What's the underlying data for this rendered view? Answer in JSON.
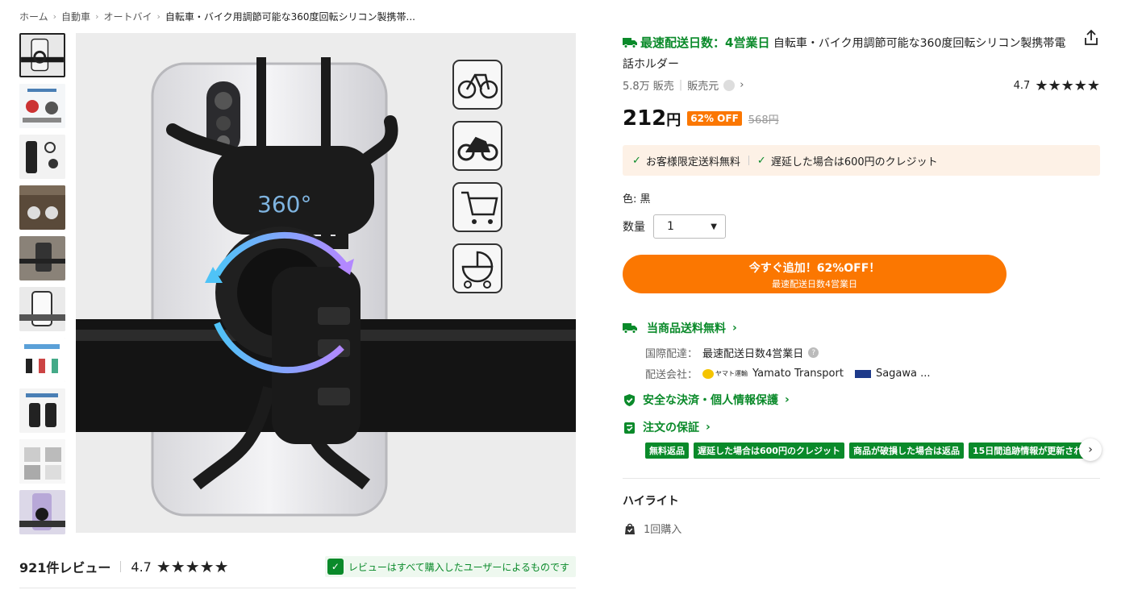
{
  "breadcrumb": {
    "items": [
      "ホーム",
      "自動車",
      "オートバイ",
      "自転車・バイク用調節可能な360度回転シリコン製携帯..."
    ],
    "separator": "›"
  },
  "gallery": {
    "thumbnail_count": 10,
    "main_image": {
      "badge_text": "360°",
      "icons": [
        "bicycle-icon",
        "motorcycle-icon",
        "shopping-cart-icon",
        "stroller-icon"
      ]
    }
  },
  "reviews": {
    "count_label": "921件レビュー",
    "rating": "4.7",
    "stars": "★★★★★",
    "rating_value": 4.7,
    "verified_text": "レビューはすべて購入したユーザーによるものです"
  },
  "product": {
    "fast_delivery": "最速配送日数：4営業日",
    "title": "自転車・バイク用調節可能な360度回転シリコン製携帯電話ホルダー",
    "sold": "5.8万 販売",
    "seller_label": "販売元",
    "rating": "4.7",
    "stars": "★★★★★",
    "price": "212",
    "currency": "円",
    "discount": "62% OFF",
    "original_price": "568円"
  },
  "promo": {
    "item1": "お客様限定送料無料",
    "item2": "遅延した場合は600円のクレジット"
  },
  "options": {
    "color_label": "色: 黒",
    "quantity_label": "数量",
    "quantity_value": "1"
  },
  "cta": {
    "line1": "今すぐ追加！62%OFF！",
    "line2": "最速配送日数4営業日"
  },
  "shipping": {
    "title": "当商品送料無料",
    "intl_label": "国際配達：",
    "intl_value": "最速配送日数4営業日",
    "carrier_label": "配送会社：",
    "yamato_small": "ヤマト運輸",
    "yamato": "Yamato Transport",
    "sagawa": "Sagawa ..."
  },
  "safety": {
    "payment": "安全な決済・個人情報保護",
    "guarantee": "注文の保証"
  },
  "guarantee_tags": [
    "無料返品",
    "遅延した場合は600円のクレジット",
    "商品が破損した場合は返品",
    "15日間追跡情報が更新され"
  ],
  "highlights": {
    "title": "ハイライト",
    "purchase": "1回購入"
  },
  "colors": {
    "accent_orange": "#fb7701",
    "green": "#0a8a2a",
    "promo_bg": "#fdf1e6"
  }
}
